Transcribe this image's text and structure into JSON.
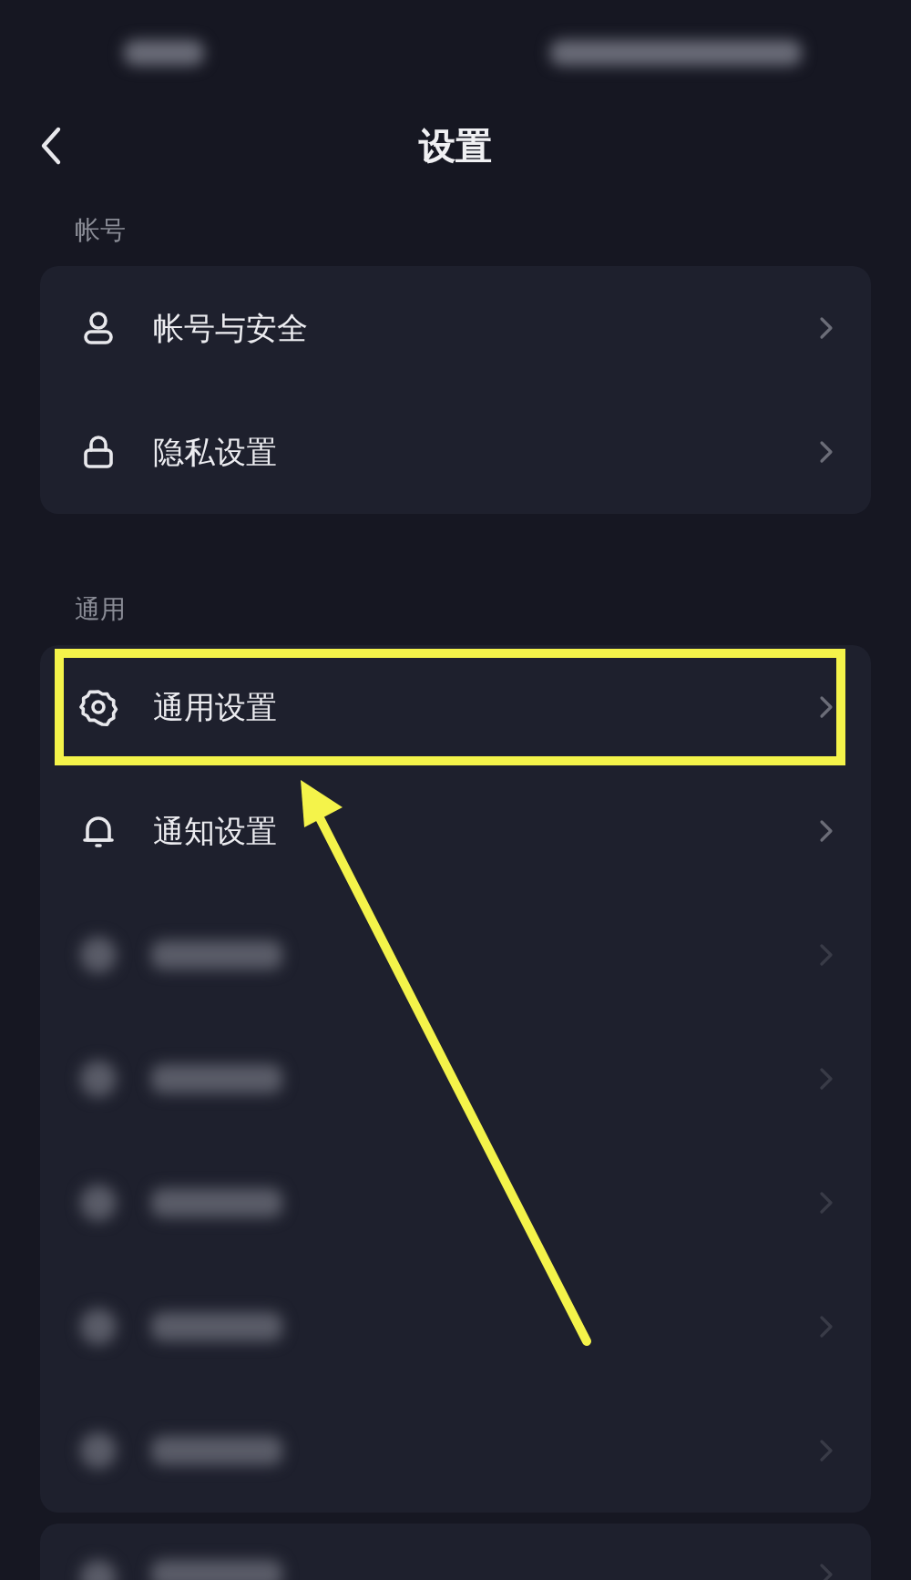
{
  "status_bar": {
    "kind": "blurred"
  },
  "header": {
    "title": "设置"
  },
  "sections": [
    {
      "title": "帐号",
      "items": [
        {
          "kind": "row",
          "label": "帐号与安全",
          "highlighted": false
        },
        {
          "kind": "row",
          "label": "隐私设置",
          "highlighted": false
        }
      ]
    },
    {
      "title": "通用",
      "items": [
        {
          "kind": "row",
          "label": "通用设置",
          "highlighted": true
        },
        {
          "kind": "row",
          "label": "通知设置",
          "highlighted": false
        },
        {
          "kind": "blurred",
          "highlighted": false
        },
        {
          "kind": "blurred",
          "highlighted": false
        },
        {
          "kind": "blurred",
          "highlighted": false
        },
        {
          "kind": "blurred",
          "highlighted": false
        },
        {
          "kind": "blurred",
          "highlighted": false
        }
      ]
    },
    {
      "items": [
        {
          "kind": "blurred",
          "highlighted": false
        }
      ]
    }
  ]
}
